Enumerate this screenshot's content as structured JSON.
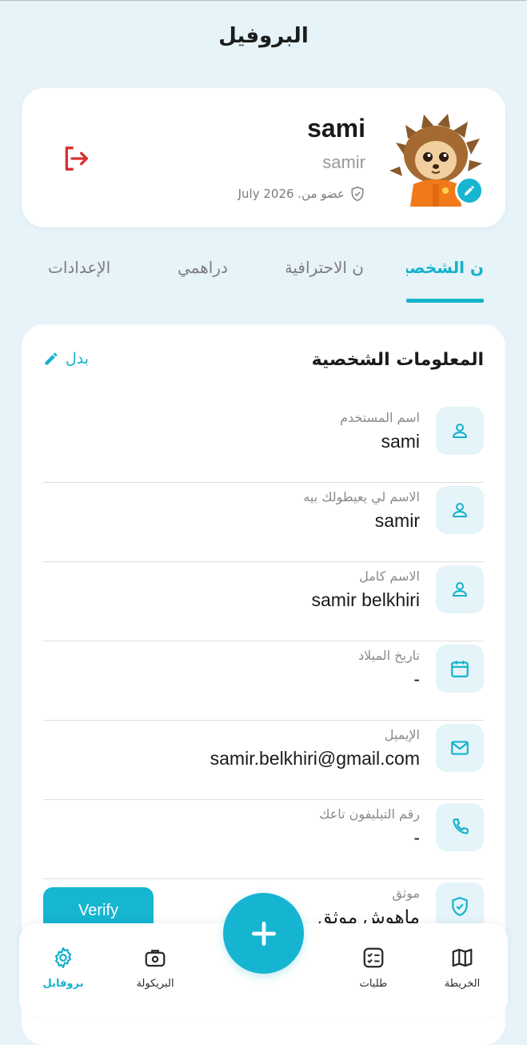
{
  "header": {
    "title": "البروفيل"
  },
  "profile": {
    "display_name": "sami",
    "username": "samir",
    "member_since": "عضو من. July 2026"
  },
  "tabs": [
    {
      "label": "ن الشخصية",
      "active": true
    },
    {
      "label": "ن الاحترافية",
      "active": false
    },
    {
      "label": "دراهمي",
      "active": false
    },
    {
      "label": "الإعدادات",
      "active": false
    }
  ],
  "section": {
    "title": "المعلومات الشخصية",
    "edit_label": "بدل"
  },
  "fields": [
    {
      "label": "اسم المستخدم",
      "value": "sami",
      "icon": "user-icon"
    },
    {
      "label": "الاسم لي يعيطولك بيه",
      "value": "samir",
      "icon": "user-icon"
    },
    {
      "label": "الاسم كامل",
      "value": "samir belkhiri",
      "icon": "user-icon"
    },
    {
      "label": "تاريخ الميلاد",
      "value": "-",
      "icon": "calendar-icon"
    },
    {
      "label": "الإيميل",
      "value": "samir.belkhiri@gmail.com",
      "icon": "mail-icon"
    },
    {
      "label": "رقم التيليفون تاعك",
      "value": "-",
      "icon": "phone-icon"
    },
    {
      "label": "موثق",
      "value": "ماهوش موثق",
      "icon": "shield-check-icon"
    }
  ],
  "verify_button": "Verify",
  "bottom_nav": [
    {
      "label": "بروفايل",
      "icon": "gear-icon",
      "active": true
    },
    {
      "label": "البريكولة",
      "icon": "briefcase-icon",
      "active": false
    },
    {
      "label": "طلبات",
      "icon": "checklist-icon",
      "active": false
    },
    {
      "label": "الخريطة",
      "icon": "map-icon",
      "active": false
    }
  ],
  "colors": {
    "accent": "#15b2cc",
    "background": "#e6f3f9",
    "logout": "#d93030"
  }
}
